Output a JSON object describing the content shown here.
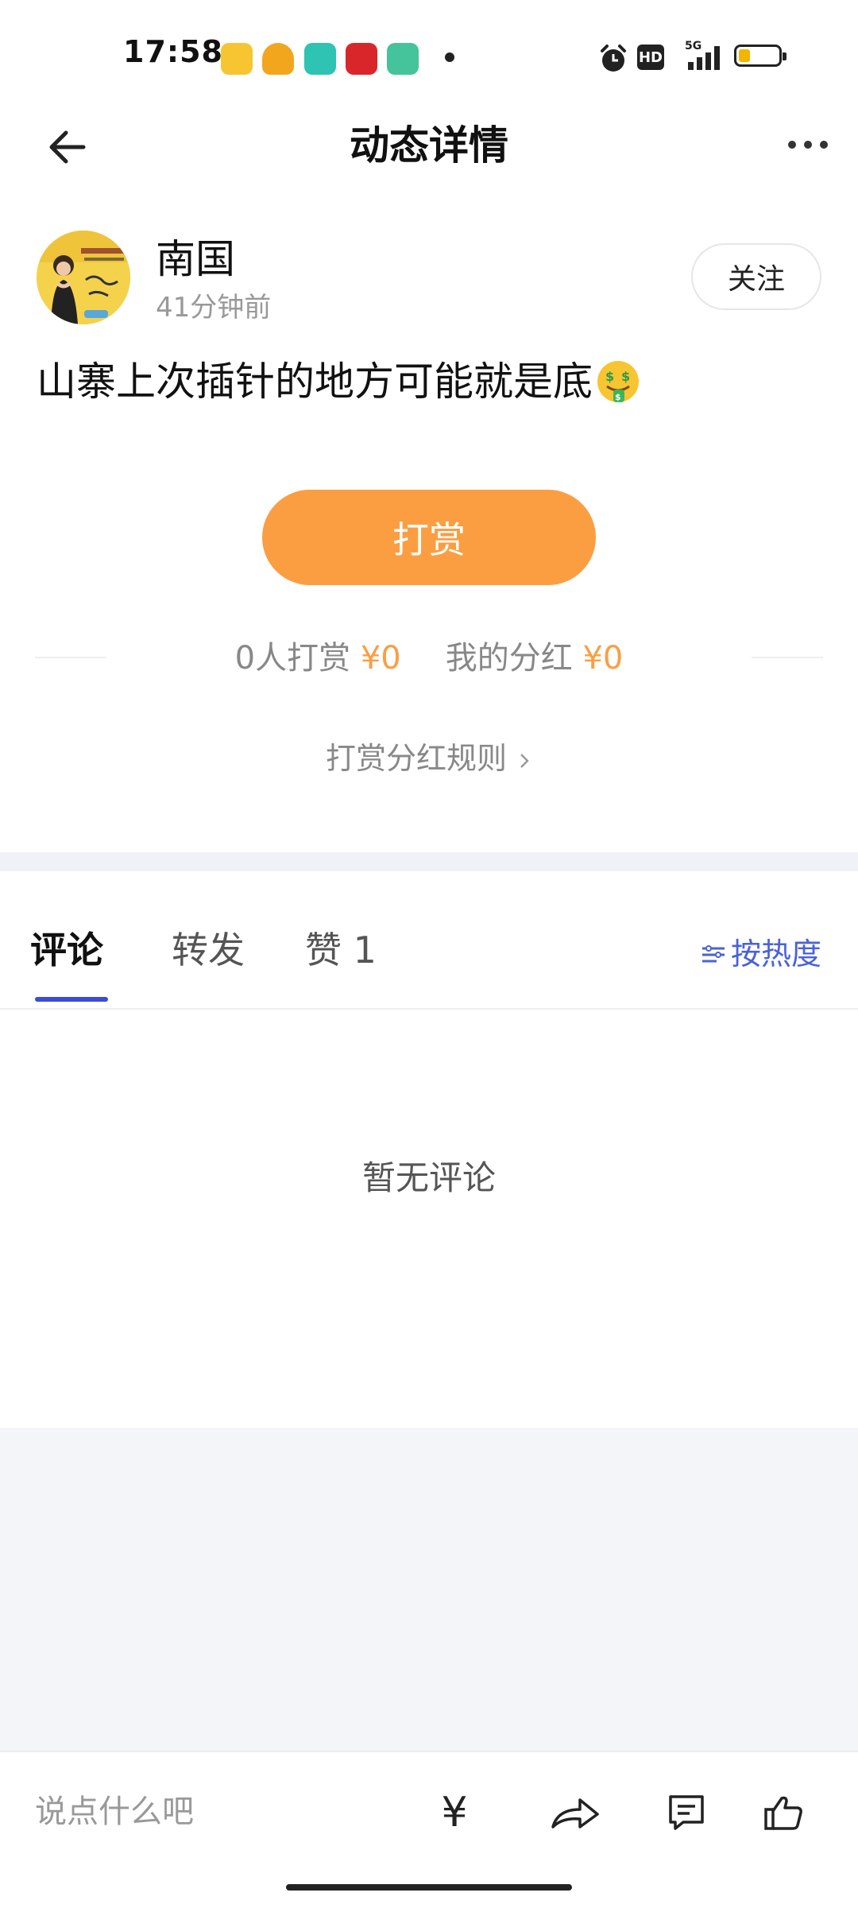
{
  "status_bar": {
    "time": "17:58",
    "hd_label": "HD",
    "network": "5G",
    "battery_level": 0.3,
    "app_icon_colors": [
      "#f7c531",
      "#f2a61e",
      "#2ec3b2",
      "#d9262b",
      "#45c39a"
    ]
  },
  "header": {
    "title": "动态详情"
  },
  "post": {
    "author_name": "南国",
    "time_ago": "41分钟前",
    "follow_label": "关注",
    "content": "山寨上次插针的地方可能就是底"
  },
  "reward": {
    "button_label": "打赏",
    "count_label": "0人打赏",
    "count_amount": "¥0",
    "dividend_label": "我的分红",
    "dividend_amount": "¥0",
    "rules_label": "打赏分红规则",
    "accent_color": "#fb9e42"
  },
  "tabs": {
    "items": [
      {
        "label": "评论",
        "active": true
      },
      {
        "label": "转发",
        "active": false
      },
      {
        "label": "赞 1",
        "active": false
      }
    ],
    "sort_label": "按热度",
    "underline_color": "#3d4bd8"
  },
  "comments": {
    "empty_text": "暂无评论"
  },
  "bottom_bar": {
    "input_placeholder": "说点什么吧",
    "yen_glyph": "¥",
    "icons": [
      "yen-icon",
      "share-icon",
      "comment-icon",
      "thumbs-up-icon"
    ]
  }
}
